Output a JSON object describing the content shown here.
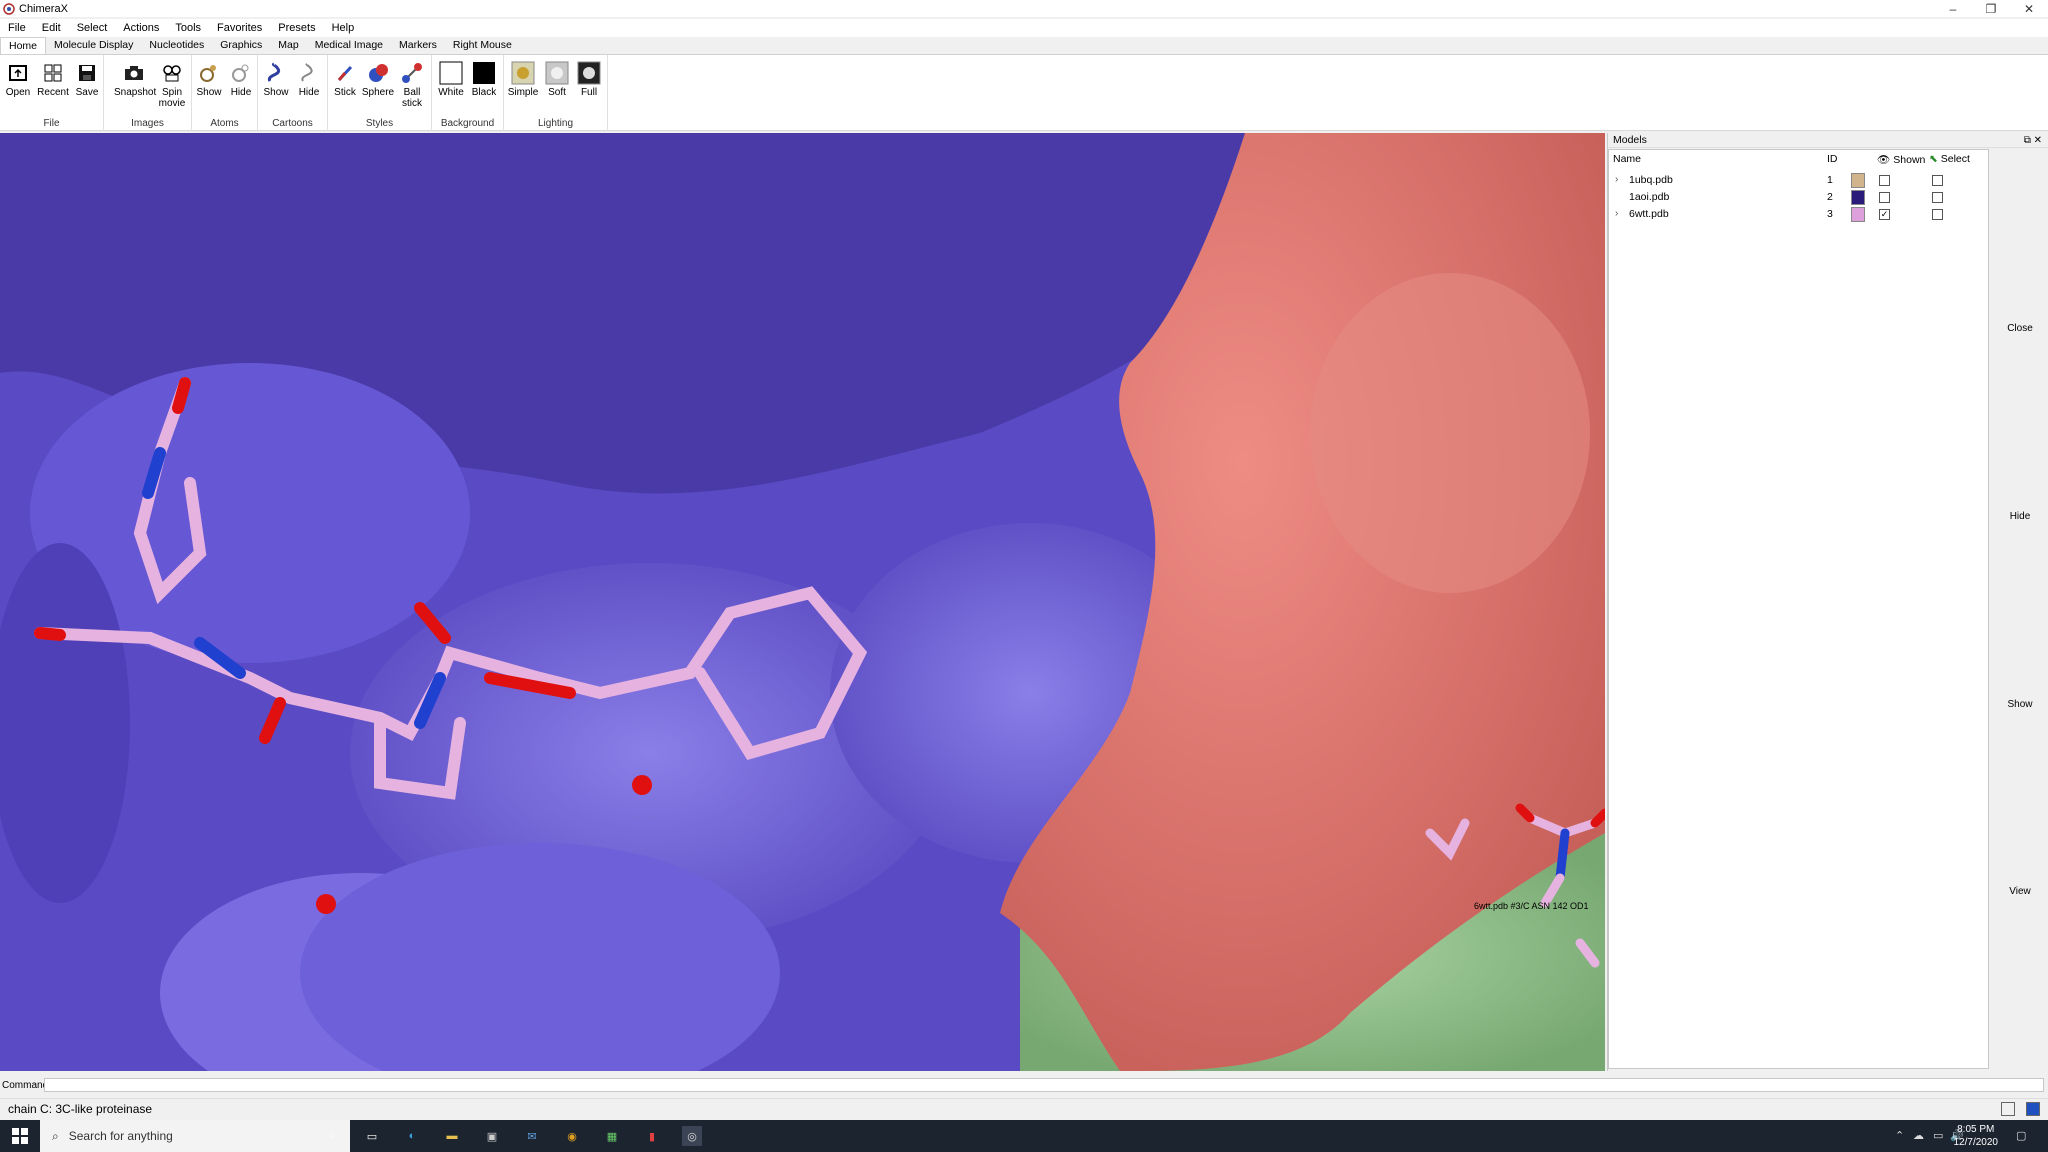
{
  "window": {
    "title": "ChimeraX"
  },
  "menubar": [
    "File",
    "Edit",
    "Select",
    "Actions",
    "Tools",
    "Favorites",
    "Presets",
    "Help"
  ],
  "ribbon_tabs": [
    "Home",
    "Molecule Display",
    "Nucleotides",
    "Graphics",
    "Map",
    "Medical Image",
    "Markers",
    "Right Mouse"
  ],
  "ribbon": {
    "file": {
      "label": "File",
      "buttons": [
        "Open",
        "Recent",
        "Save"
      ]
    },
    "images": {
      "label": "Images",
      "buttons": [
        "Snapshot",
        "Spin movie"
      ]
    },
    "atoms": {
      "label": "Atoms",
      "buttons": [
        "Show",
        "Hide"
      ]
    },
    "cartoons": {
      "label": "Cartoons",
      "buttons": [
        "Show",
        "Hide"
      ]
    },
    "styles": {
      "label": "Styles",
      "buttons": [
        "Stick",
        "Sphere",
        "Ball stick"
      ]
    },
    "background": {
      "label": "Background",
      "buttons": [
        "White",
        "Black"
      ]
    },
    "lighting": {
      "label": "Lighting",
      "buttons": [
        "Simple",
        "Soft",
        "Full"
      ]
    }
  },
  "viewport": {
    "hover_label": "6wtt.pdb #3/C ASN 142 OD1"
  },
  "models_panel": {
    "title": "Models",
    "headers": {
      "name": "Name",
      "id": "ID",
      "shown": "Shown",
      "select": "Select"
    },
    "rows": [
      {
        "name": "1ubq.pdb",
        "id": "1",
        "color": "#d2b48c",
        "shown": false,
        "selected": false,
        "expandable": true
      },
      {
        "name": "1aoi.pdb",
        "id": "2",
        "color": "#2a1a7a",
        "shown": false,
        "selected": false,
        "expandable": false
      },
      {
        "name": "6wtt.pdb",
        "id": "3",
        "color": "#dda0dd",
        "shown": true,
        "selected": false,
        "expandable": true
      }
    ],
    "side_buttons": [
      "Close",
      "Hide",
      "Show",
      "View"
    ]
  },
  "command": {
    "label": "Command:",
    "value": ""
  },
  "status": {
    "text": "chain C: 3C-like proteinase"
  },
  "taskbar": {
    "search_placeholder": "Search for anything",
    "time": "8:05 PM",
    "date": "12/7/2020"
  },
  "colors": {
    "surface_blue": "#6a5acd",
    "surface_salmon": "#e07b72",
    "surface_green": "#8fbf8a",
    "ligand_pink": "#e6b3e0"
  }
}
